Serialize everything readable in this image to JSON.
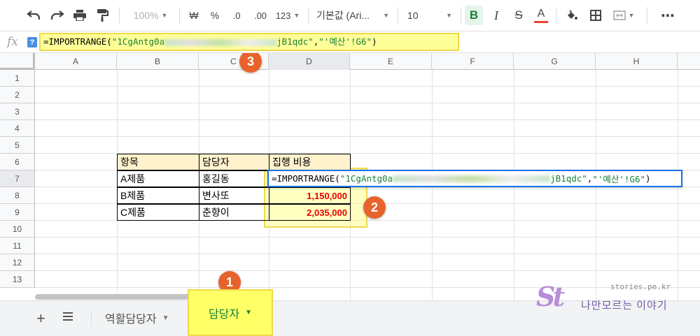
{
  "toolbar": {
    "zoom": "100%",
    "currency": "₩",
    "percent": "%",
    "dec_decrease": ".0",
    "dec_increase": ".00",
    "more_formats": "123",
    "font_family": "기본값 (Ari...",
    "font_size": "10",
    "bold": "B",
    "italic": "I",
    "strike": "S",
    "text_color": "A",
    "text_color_hex": "#ea4335",
    "more": "⋯"
  },
  "formula_bar": {
    "fx": "fx",
    "help": "?",
    "prefix": "=IMPORTRANGE(",
    "arg1_start": "\"1CgAntg0a",
    "arg1_end": "jB1qdc\"",
    "comma": ",",
    "arg2": "\"'예산'!G6\"",
    "suffix": ")"
  },
  "columns": [
    "A",
    "B",
    "C",
    "D",
    "E",
    "F",
    "G",
    "H"
  ],
  "rows": [
    "1",
    "2",
    "3",
    "4",
    "5",
    "6",
    "7",
    "8",
    "9",
    "10",
    "11",
    "12",
    "13"
  ],
  "table": {
    "headers": [
      "항목",
      "담당자",
      "집행 비용"
    ],
    "rows": [
      {
        "item": "A제품",
        "owner": "홍길동",
        "cost": ""
      },
      {
        "item": "B제품",
        "owner": "변사또",
        "cost": "1,150,000"
      },
      {
        "item": "C제품",
        "owner": "춘향이",
        "cost": "2,035,000"
      }
    ]
  },
  "cell_edit": {
    "prefix": "=IMPORTRANGE(",
    "arg1_start": "\"1CgAntg0a",
    "arg1_end": "jB1qdc\"",
    "comma": ",",
    "arg2": "\"'예산'!G6\"",
    "suffix": ")"
  },
  "badges": [
    "1",
    "2",
    "3"
  ],
  "sheets": {
    "add": "+",
    "tabs": [
      {
        "label": "역활담당자"
      },
      {
        "label": "담당자"
      }
    ]
  },
  "watermark": {
    "logo": "St",
    "url": "stories.pe.kr",
    "name": "나만모르는 이야기"
  },
  "colors": {
    "accent_green": "#188038",
    "highlight_yellow": "#ffff66",
    "badge_orange": "#e8632b",
    "selection_blue": "#1a73e8",
    "negative_red": "#e60000"
  }
}
